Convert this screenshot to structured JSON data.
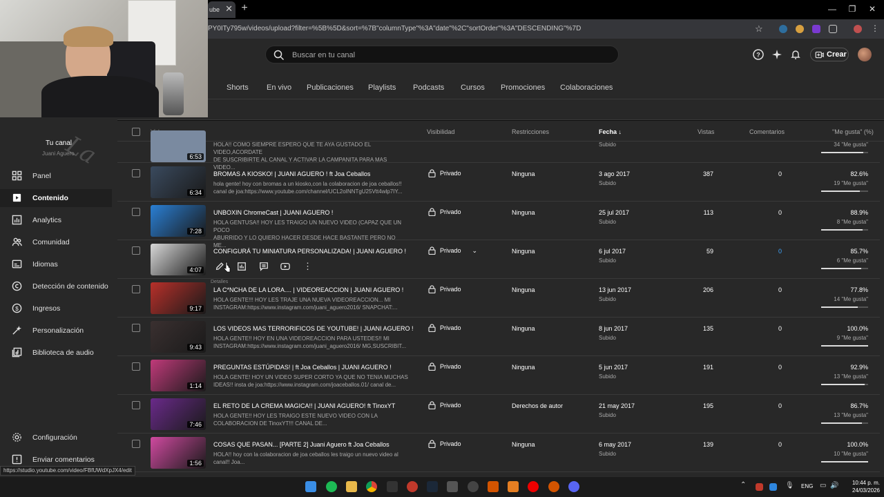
{
  "browser": {
    "tab_fragment": "ube",
    "tab_close": "✕",
    "new_tab": "+",
    "url": "PY0ITy795w/videos/upload?filter=%5B%5D&sort=%7B\"columnType\"%3A\"date\"%2C\"sortOrder\"%3A\"DESCENDING\"%7D",
    "status_url": "https://studio.youtube.com/video/FBfUWdXpJX4/edit"
  },
  "header": {
    "search_placeholder": "Buscar en tu canal",
    "create_label": "Crear"
  },
  "tabs": [
    "Shorts",
    "En vivo",
    "Publicaciones",
    "Playlists",
    "Podcasts",
    "Cursos",
    "Promociones",
    "Colaboraciones"
  ],
  "table_headers": {
    "video": "Video",
    "visibility": "Visibilidad",
    "restrictions": "Restricciones",
    "date": "Fecha",
    "views": "Vistas",
    "comments": "Comentarios",
    "likes": "\"Me gusta\" (%)"
  },
  "sidebar": {
    "channel_title": "Tu canal",
    "channel_name": "Juani Aguero",
    "items": [
      "Panel",
      "Contenido",
      "Analytics",
      "Comunidad",
      "Idiomas",
      "Detección de contenido",
      "Ingresos",
      "Personalización",
      "Biblioteca de audio"
    ],
    "bottom_items": [
      "Configuración",
      "Enviar comentarios"
    ]
  },
  "top_partial_row": {
    "duration": "6:53",
    "desc_line1": "HOLA!! COMO SIEMPRE ESPERO QUE TE AYA GUSTADO EL VIDEO,ACORDATE",
    "desc_line2": "DE SUSCRIBIRTE AL CANAL Y ACTIVAR LA CAMPANITA PARA MAS VIDEO...",
    "status": "Subido",
    "likes": "34 \"Me gusta\"",
    "like_ratio": 0.9
  },
  "rows": [
    {
      "title": "BROMAS A KIOSKO! | JUANI AGUERO ! ft Joa Ceballos",
      "desc1": "hola gente! hoy con bromas a un kiosko,con la colaboracion de joa ceballos!!",
      "desc2": "canal de joa:https://www.youtube.com/channel/UCL2oINNTgU25Vtt4wlp7IY...",
      "duration": "6:34",
      "visibility": "Privado",
      "restrictions": "Ninguna",
      "date": "3 ago 2017",
      "status": "Subido",
      "views": "387",
      "comments": "0",
      "pct": "82.6%",
      "likes": "19 \"Me gusta\"",
      "ratio": 0.826,
      "thumb": "#3a4a5e"
    },
    {
      "title": "UNBOXIN ChromeCast | JUANI AGUERO !",
      "desc1": "HOLA GENTUSA!! HOY LES TRAIGO UN NUEVO VIDEO (CAPAZ QUE UN POCO",
      "desc2": "ABURRIDO Y LO QUIERO HACER DESDE HACE BASTANTE PERO NO ME...",
      "duration": "7:28",
      "visibility": "Privado",
      "restrictions": "Ninguna",
      "date": "25 jul 2017",
      "status": "Subido",
      "views": "113",
      "comments": "0",
      "pct": "88.9%",
      "likes": "8 \"Me gusta\"",
      "ratio": 0.889,
      "thumb": "#2a7fd4"
    },
    {
      "title": "CONFIGURÁ TU MINIATURA PERSONALIZADA! | JUANI AGUERO !",
      "desc1": "",
      "desc2": "",
      "duration": "4:07",
      "visibility": "Privado",
      "restrictions": "Ninguna",
      "date": "6 jul 2017",
      "status": "Subido",
      "views": "59",
      "comments": "0",
      "pct": "85.7%",
      "likes": "6 \"Me gusta\"",
      "ratio": 0.857,
      "thumb": "#d8d8d8"
    },
    {
      "title": "LA C*NCHA DE LA LORA.... | VIDEOREACCION | JUANI AGUERO !",
      "desc1": "HOLA GENTE!!! HOY LES TRAJE UNA NUEVA VIDEOREACCION... MI",
      "desc2": "INSTAGRAM:https://www.instagram.com/juani_aguero2016/ SNAPCHAT:...",
      "duration": "9:17",
      "visibility": "Privado",
      "restrictions": "Ninguna",
      "date": "13 jun 2017",
      "status": "Subido",
      "views": "206",
      "comments": "0",
      "pct": "77.8%",
      "likes": "14 \"Me gusta\"",
      "ratio": 0.778,
      "thumb": "#b8302a"
    },
    {
      "title": "LOS VIDEOS MAS TERRORIFICOS DE YOUTUBE! | JUANI AGUERO !",
      "desc1": "HOLA GENTE!! HOY EN UNA VIDEOREACCION PARA USTEDES!! MI",
      "desc2": "INSTAGRAM:https://www.instagram.com/juani_aguero2016/ MG,SUSCRIBIT...",
      "duration": "9:43",
      "visibility": "Privado",
      "restrictions": "Ninguna",
      "date": "8 jun 2017",
      "status": "Subido",
      "views": "135",
      "comments": "0",
      "pct": "100.0%",
      "likes": "9 \"Me gusta\"",
      "ratio": 1.0,
      "thumb": "#3a3030"
    },
    {
      "title": "PREGUNTAS ESTÚPIDAS! | ft Joa Ceballos | JUANI AGUERO !",
      "desc1": "HOLA GENTE! HOY UN VIDEO SUPER CORTO YA QUE NO TENIA MUCHAS",
      "desc2": "IDEAS!! insta de joa:https://www.instagram.com/joaceballos.01/ canal de...",
      "duration": "1:14",
      "visibility": "Privado",
      "restrictions": "Ninguna",
      "date": "5 jun 2017",
      "status": "Subido",
      "views": "191",
      "comments": "0",
      "pct": "92.9%",
      "likes": "13 \"Me gusta\"",
      "ratio": 0.929,
      "thumb": "#c03a7a"
    },
    {
      "title": "EL RETO DE LA CREMA MAGICA!! | JUANI AGUERO! ft TinoxYT",
      "desc1": "HOLA GENTE!! HOY LES TRAIGO ESTE NUEVO VIDEO CON LA",
      "desc2": "COLABORACION DE TinoxYT!!! CANAL DE...",
      "duration": "7:46",
      "visibility": "Privado",
      "restrictions": "Derechos de autor",
      "date": "21 may 2017",
      "status": "Subido",
      "views": "195",
      "comments": "0",
      "pct": "86.7%",
      "likes": "13 \"Me gusta\"",
      "ratio": 0.867,
      "thumb": "#6a2a8a"
    },
    {
      "title": "COSAS QUE PASAN... [PARTE 2] Juani Aguero ft Joa Ceballos",
      "desc1": "HOLA!! hoy con la colaboracion de joa ceballos les traigo un nuevo video al",
      "desc2": "canal!! Joa...",
      "duration": "1:56",
      "visibility": "Privado",
      "restrictions": "Ninguna",
      "date": "6 may 2017",
      "status": "Subido",
      "views": "139",
      "comments": "0",
      "pct": "100.0%",
      "likes": "10 \"Me gusta\"",
      "ratio": 1.0,
      "thumb": "#d04aa0"
    }
  ],
  "hover_tooltip": "Detalles",
  "taskbar": {
    "lang": "ENG",
    "time": "10:44 p. m.",
    "date": "24/03/2026"
  },
  "colors": {
    "background": "#282828",
    "accent_blue": "#3ea6ff"
  }
}
